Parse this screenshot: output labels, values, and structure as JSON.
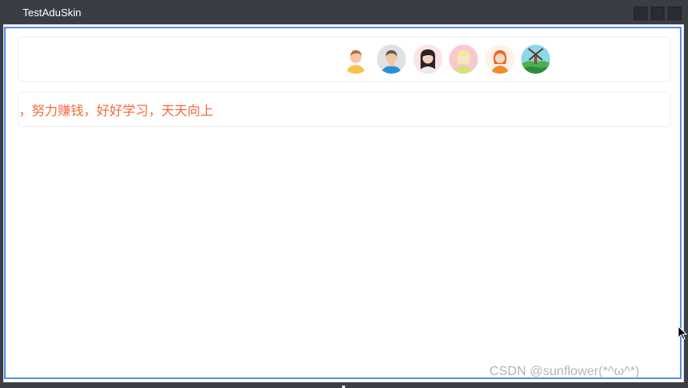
{
  "window": {
    "title": "TestAduSkin",
    "controls": [
      "minimize-icon",
      "maximize-icon",
      "close-icon"
    ]
  },
  "avatars": [
    {
      "name": "boy-avatar-icon"
    },
    {
      "name": "man-avatar-icon"
    },
    {
      "name": "woman-dark-hair-avatar-icon"
    },
    {
      "name": "girl-yellow-hair-avatar-icon"
    },
    {
      "name": "woman-red-hair-avatar-icon"
    },
    {
      "name": "windmill-landscape-avatar-icon"
    }
  ],
  "marquee": {
    "text": "E，努力赚钱，好好学习，天天向上",
    "color": "#f26b3a"
  },
  "watermark": "CSDN @sunflower(*^ω^*)",
  "colors": {
    "frame_border": "#5a8fe6",
    "titlebar": "#3a3d44"
  }
}
